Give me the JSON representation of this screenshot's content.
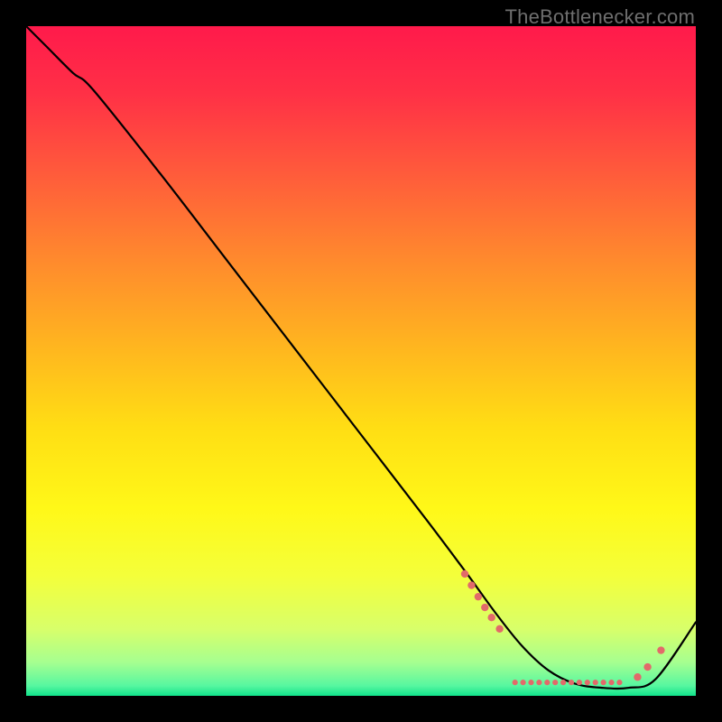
{
  "watermark": "TheBottlenecker.com",
  "chart_data": {
    "type": "line",
    "title": "",
    "xlabel": "",
    "ylabel": "",
    "xlim": [
      0,
      100
    ],
    "ylim": [
      0,
      100
    ],
    "grid": false,
    "legend": false,
    "background_gradient": {
      "stops": [
        {
          "offset": 0.0,
          "color": "#ff1a4b"
        },
        {
          "offset": 0.1,
          "color": "#ff3046"
        },
        {
          "offset": 0.22,
          "color": "#ff5b3b"
        },
        {
          "offset": 0.35,
          "color": "#ff8a2d"
        },
        {
          "offset": 0.48,
          "color": "#ffb61f"
        },
        {
          "offset": 0.6,
          "color": "#ffde14"
        },
        {
          "offset": 0.72,
          "color": "#fff818"
        },
        {
          "offset": 0.82,
          "color": "#f4ff3a"
        },
        {
          "offset": 0.9,
          "color": "#d8ff6a"
        },
        {
          "offset": 0.95,
          "color": "#a6ff90"
        },
        {
          "offset": 0.985,
          "color": "#57f7a0"
        },
        {
          "offset": 1.0,
          "color": "#10e38b"
        }
      ]
    },
    "series": [
      {
        "name": "curve",
        "color": "#000000",
        "x": [
          0.0,
          3.0,
          7.0,
          10.0,
          20.0,
          30.0,
          40.0,
          50.0,
          60.0,
          66.0,
          70.0,
          74.0,
          78.0,
          82.0,
          86.0,
          90.0,
          94.0,
          100.0
        ],
        "y": [
          100.0,
          97.0,
          93.0,
          90.5,
          78.0,
          65.0,
          52.0,
          39.0,
          26.0,
          18.0,
          12.5,
          7.5,
          3.8,
          1.8,
          1.2,
          1.2,
          2.5,
          11.0
        ]
      }
    ],
    "markers": {
      "color": "#e26a6a",
      "radius_small": 3.1,
      "radius_large": 4.2,
      "points": [
        {
          "x": 65.5,
          "y": 18.2,
          "r": "large"
        },
        {
          "x": 66.5,
          "y": 16.5,
          "r": "large"
        },
        {
          "x": 67.5,
          "y": 14.8,
          "r": "large"
        },
        {
          "x": 68.5,
          "y": 13.2,
          "r": "large"
        },
        {
          "x": 69.5,
          "y": 11.7,
          "r": "large"
        },
        {
          "x": 70.7,
          "y": 10.0,
          "r": "large"
        },
        {
          "x": 73.0,
          "y": 2.0,
          "r": "small"
        },
        {
          "x": 74.2,
          "y": 2.0,
          "r": "small"
        },
        {
          "x": 75.4,
          "y": 2.0,
          "r": "small"
        },
        {
          "x": 76.6,
          "y": 2.0,
          "r": "small"
        },
        {
          "x": 77.8,
          "y": 2.0,
          "r": "small"
        },
        {
          "x": 79.0,
          "y": 2.0,
          "r": "small"
        },
        {
          "x": 80.2,
          "y": 2.0,
          "r": "small"
        },
        {
          "x": 81.4,
          "y": 2.0,
          "r": "small"
        },
        {
          "x": 82.6,
          "y": 2.0,
          "r": "small"
        },
        {
          "x": 83.8,
          "y": 2.0,
          "r": "small"
        },
        {
          "x": 85.0,
          "y": 2.0,
          "r": "small"
        },
        {
          "x": 86.2,
          "y": 2.0,
          "r": "small"
        },
        {
          "x": 87.4,
          "y": 2.0,
          "r": "small"
        },
        {
          "x": 88.6,
          "y": 2.0,
          "r": "small"
        },
        {
          "x": 91.3,
          "y": 2.8,
          "r": "large"
        },
        {
          "x": 92.8,
          "y": 4.3,
          "r": "large"
        },
        {
          "x": 94.8,
          "y": 6.8,
          "r": "large"
        }
      ]
    }
  }
}
